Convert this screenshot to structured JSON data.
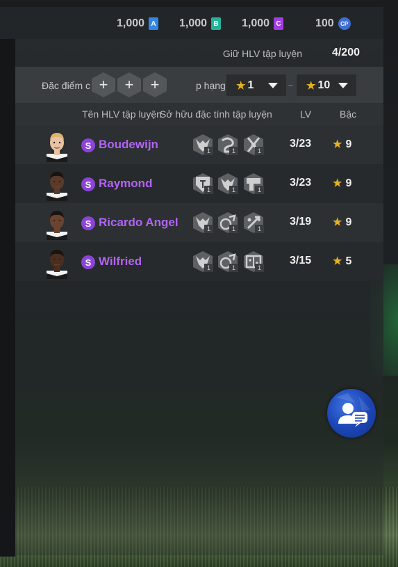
{
  "currencies": [
    {
      "value": "1,000",
      "badge": "A",
      "color": "#2f87e6"
    },
    {
      "value": "1,000",
      "badge": "B",
      "color": "#24b39a"
    },
    {
      "value": "1,000",
      "badge": "C",
      "color": "#a23de0"
    },
    {
      "value": "100",
      "badge": "CP",
      "color": "#3d6fd6"
    }
  ],
  "hold": {
    "label": "Giữ HLV tập luyện",
    "count": "4/200"
  },
  "filter": {
    "trait_label": "Đặc điểm c",
    "rank_label": "p hạng",
    "rank_min": "1",
    "rank_max": "10",
    "separator": "~",
    "plus": "+"
  },
  "columns": {
    "name": "Tên HLV tập luyện",
    "traits": "Sở hữu đặc tính tập luyện",
    "lv": "LV",
    "grade": "Bậc"
  },
  "coaches": [
    {
      "rank": "S",
      "name": "Boudewijn",
      "lv": "3/23",
      "grade": "9",
      "traits": [
        {
          "icon": "trainer-figure-icon",
          "lvl": "1"
        },
        {
          "icon": "curve-arrow-icon",
          "lvl": "1"
        },
        {
          "icon": "cross-swords-icon",
          "lvl": "1"
        }
      ]
    },
    {
      "rank": "S",
      "name": "Raymond",
      "lv": "3/23",
      "grade": "9",
      "traits": [
        {
          "icon": "shield-crest-icon",
          "lvl": "1"
        },
        {
          "icon": "trainer-figure-icon",
          "lvl": "1"
        },
        {
          "icon": "flag-icon",
          "lvl": "1"
        }
      ]
    },
    {
      "rank": "S",
      "name": "Ricardo Angel",
      "lv": "3/19",
      "grade": "9",
      "traits": [
        {
          "icon": "trainer-figure-icon",
          "lvl": "1"
        },
        {
          "icon": "ball-kick-icon",
          "lvl": "1"
        },
        {
          "icon": "tactic-arrow-icon",
          "lvl": "1"
        }
      ]
    },
    {
      "rank": "S",
      "name": "Wilfried",
      "lv": "3/15",
      "grade": "5",
      "traits": [
        {
          "icon": "trainer-figure-icon",
          "lvl": "1"
        },
        {
          "icon": "ball-kick-icon",
          "lvl": "1"
        },
        {
          "icon": "formation-board-icon",
          "lvl": "1"
        }
      ]
    }
  ],
  "chat": {
    "icon": "coach-chat-icon"
  }
}
